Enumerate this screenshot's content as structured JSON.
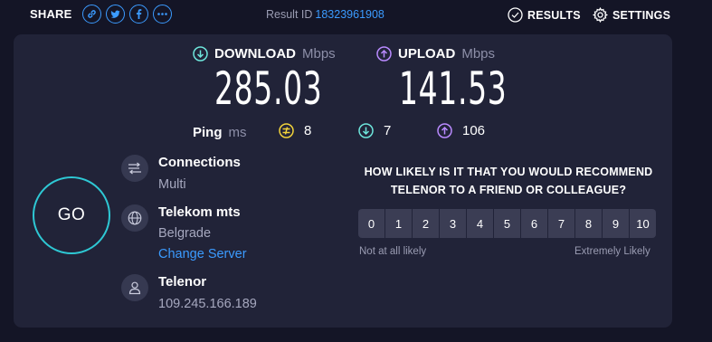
{
  "topbar": {
    "share_label": "SHARE",
    "share_icons": [
      "link-icon",
      "twitter-icon",
      "facebook-icon",
      "more-icon"
    ],
    "result_label": "Result ID",
    "result_id": "18323961908",
    "results_label": "RESULTS",
    "settings_label": "SETTINGS"
  },
  "download": {
    "label": "DOWNLOAD",
    "unit": "Mbps",
    "value": "285.03",
    "color": "#6ee6dc"
  },
  "upload": {
    "label": "UPLOAD",
    "unit": "Mbps",
    "value": "141.53",
    "color": "#b98aff"
  },
  "ping": {
    "label": "Ping",
    "unit": "ms",
    "idle": "8",
    "download": "7",
    "upload": "106",
    "idle_color": "#f2d33a"
  },
  "go_label": "GO",
  "connections": {
    "title": "Connections",
    "value": "Multi"
  },
  "server": {
    "title": "Telekom mts",
    "location": "Belgrade",
    "change_label": "Change Server"
  },
  "provider": {
    "title": "Telenor",
    "ip": "109.245.166.189"
  },
  "survey": {
    "question_line1": "HOW LIKELY IS IT THAT YOU WOULD RECOMMEND",
    "question_line2": "TELENOR TO A FRIEND OR COLLEAGUE?",
    "options": [
      "0",
      "1",
      "2",
      "3",
      "4",
      "5",
      "6",
      "7",
      "8",
      "9",
      "10"
    ],
    "low_label": "Not at all likely",
    "high_label": "Extremely Likely"
  },
  "colors": {
    "accent": "#3b9bff",
    "go_ring": "#2ec8d4",
    "panel": "#212338",
    "background": "#141526"
  }
}
